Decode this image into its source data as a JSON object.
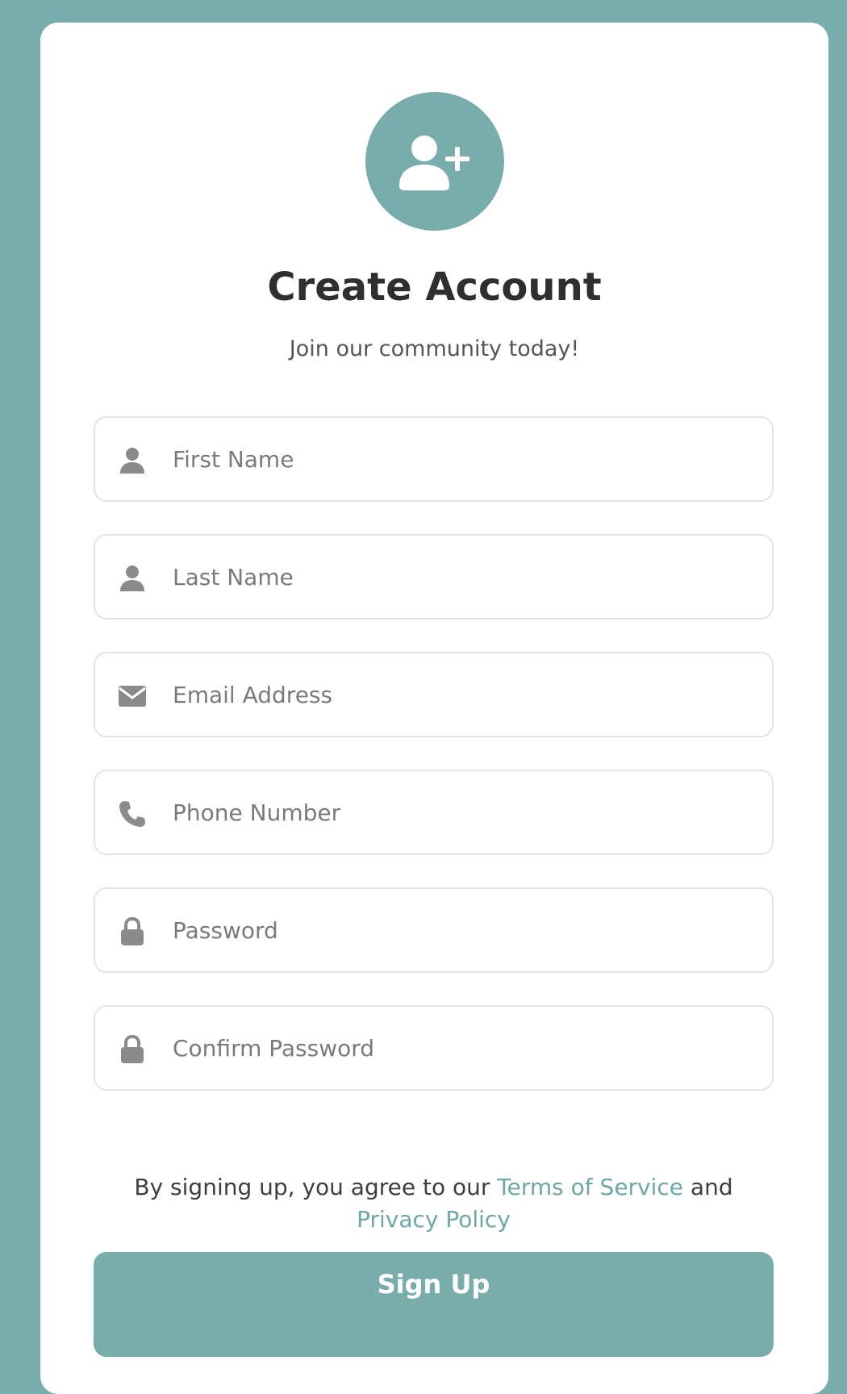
{
  "colors": {
    "background": "#78adab",
    "accent": "#78adab",
    "link": "#6ea8a6",
    "card": "#ffffff",
    "icon": "#8a8a8a"
  },
  "header": {
    "icon": "user-plus-icon",
    "title": "Create Account",
    "subtitle": "Join our community today!"
  },
  "form": {
    "fields": [
      {
        "icon": "user-icon",
        "placeholder": "First Name",
        "value": ""
      },
      {
        "icon": "user-icon",
        "placeholder": "Last Name",
        "value": ""
      },
      {
        "icon": "envelope-icon",
        "placeholder": "Email Address",
        "value": ""
      },
      {
        "icon": "phone-icon",
        "placeholder": "Phone Number",
        "value": ""
      },
      {
        "icon": "lock-icon",
        "placeholder": "Password",
        "value": ""
      },
      {
        "icon": "lock-icon",
        "placeholder": "Confirm Password",
        "value": ""
      }
    ],
    "terms": {
      "prefix": "By signing up, you agree to our ",
      "terms_link": "Terms of Service",
      "joiner": " and ",
      "privacy_link": "Privacy Policy"
    },
    "submit_label": "Sign Up"
  }
}
